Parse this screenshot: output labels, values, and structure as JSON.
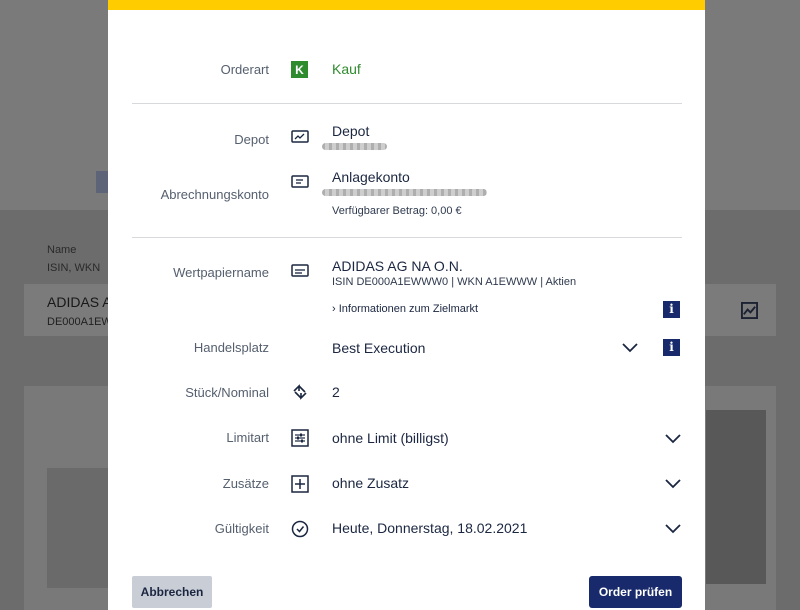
{
  "colors": {
    "accent_yellow": "#ffcc00",
    "brand_navy": "#182a6b",
    "buy_green": "#2e8b2e"
  },
  "background": {
    "table_header": {
      "name": "Name",
      "isin_wkn": "ISIN, WKN"
    },
    "row": {
      "name": "ADIDAS A",
      "isin": "DE000A1EW"
    }
  },
  "form": {
    "orderart": {
      "label": "Orderart",
      "badge": "K",
      "value": "Kauf"
    },
    "depot": {
      "label": "Depot",
      "value": "Depot"
    },
    "abrechnungskonto": {
      "label": "Abrechnungskonto",
      "value": "Anlagekonto",
      "available": "Verfügbarer Betrag: 0,00 €"
    },
    "wertpapier": {
      "label": "Wertpapiername",
      "name": "ADIDAS AG NA O.N.",
      "details": "ISIN DE000A1EWWW0 | WKN A1EWWW | Aktien",
      "target_market_link": "› Informationen zum Zielmarkt"
    },
    "handelsplatz": {
      "label": "Handelsplatz",
      "value": "Best Execution"
    },
    "stueck": {
      "label": "Stück/Nominal",
      "value": "2"
    },
    "limitart": {
      "label": "Limitart",
      "value": "ohne Limit (billigst)"
    },
    "zusaetze": {
      "label": "Zusätze",
      "value": "ohne Zusatz"
    },
    "gueltigkeit": {
      "label": "Gültigkeit",
      "value": "Heute, Donnerstag, 18.02.2021"
    }
  },
  "buttons": {
    "cancel": "Abbrechen",
    "check": "Order prüfen"
  },
  "icons": [
    "depot-icon",
    "account-icon",
    "security-icon",
    "info-icon",
    "chevron-down-icon",
    "quantity-icon",
    "limit-sliders-icon",
    "add-box-icon",
    "clock-icon",
    "chart-icon"
  ]
}
